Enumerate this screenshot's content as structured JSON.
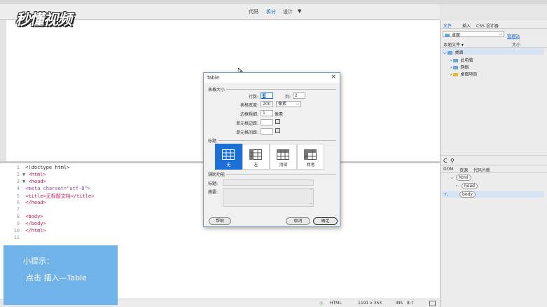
{
  "viewbar": {
    "code": "代码",
    "split": "拆分",
    "design": "设计",
    "design_arrow": "▼"
  },
  "logo": {
    "text": "秒懂视频"
  },
  "code_lines": [
    {
      "n": "1",
      "fold": "",
      "text": "<!doctype html>"
    },
    {
      "n": "2",
      "fold": "▼",
      "text": "<html>"
    },
    {
      "n": "3",
      "fold": "▼",
      "text": "<head>"
    },
    {
      "n": "4",
      "fold": "",
      "text": "<meta charset=\"utf-8\">"
    },
    {
      "n": "5",
      "fold": "",
      "text": "<title>无标题文档</title>"
    },
    {
      "n": "6",
      "fold": "",
      "text": "</head>"
    },
    {
      "n": "7",
      "fold": "",
      "text": ""
    },
    {
      "n": "8",
      "fold": "",
      "text": "<body>"
    },
    {
      "n": "9",
      "fold": "",
      "text": "</body>"
    },
    {
      "n": "10",
      "fold": "",
      "text": "</html>"
    },
    {
      "n": "11",
      "fold": "",
      "text": ""
    }
  ],
  "tip": {
    "title": "小提示：",
    "body": "点击 插入—Table"
  },
  "statusbar": {
    "mode": "HTML",
    "size": "1191 x 353",
    "ins": "INS",
    "pos": "8:7"
  },
  "dialog": {
    "title": "Table",
    "close": "×",
    "section_size": "表格大小",
    "rows_label": "行数:",
    "rows_value": "3",
    "cols_label": "列:",
    "cols_value": "2",
    "width_label": "表格宽度:",
    "width_value": "200",
    "width_unit": "像素",
    "border_label": "边框粗细:",
    "border_value": "1",
    "border_unit": "像素",
    "padding_label": "单元格边距:",
    "spacing_label": "单元格间距:",
    "section_header": "标题",
    "header_options": [
      "无",
      "左",
      "顶部",
      "两者"
    ],
    "section_access": "辅助功能",
    "caption_label": "标题:",
    "summary_label": "摘要:",
    "help_button": "帮助",
    "cancel_button": "取消",
    "ok_button": "确定"
  },
  "right_panel": {
    "tabs": [
      "文件",
      "插入",
      "CSS 设计器"
    ],
    "site": "桌面",
    "manage": "管理站",
    "local_files": "本地文件 ▾",
    "size_col": "大小",
    "tree": [
      {
        "label": "桌面",
        "type": "pc"
      },
      {
        "label": "此电脑",
        "type": "pc"
      },
      {
        "label": "网络",
        "type": "pc"
      },
      {
        "label": "桌面项目",
        "type": "folder"
      }
    ],
    "dom_tabs": [
      "DOM",
      "资源",
      "代码片断"
    ],
    "dom_nodes": [
      "html",
      "head",
      "body"
    ],
    "plus": "+,"
  },
  "colors": {
    "accent": "#1a6fd8",
    "tip_bg": "#6fb3e8"
  }
}
